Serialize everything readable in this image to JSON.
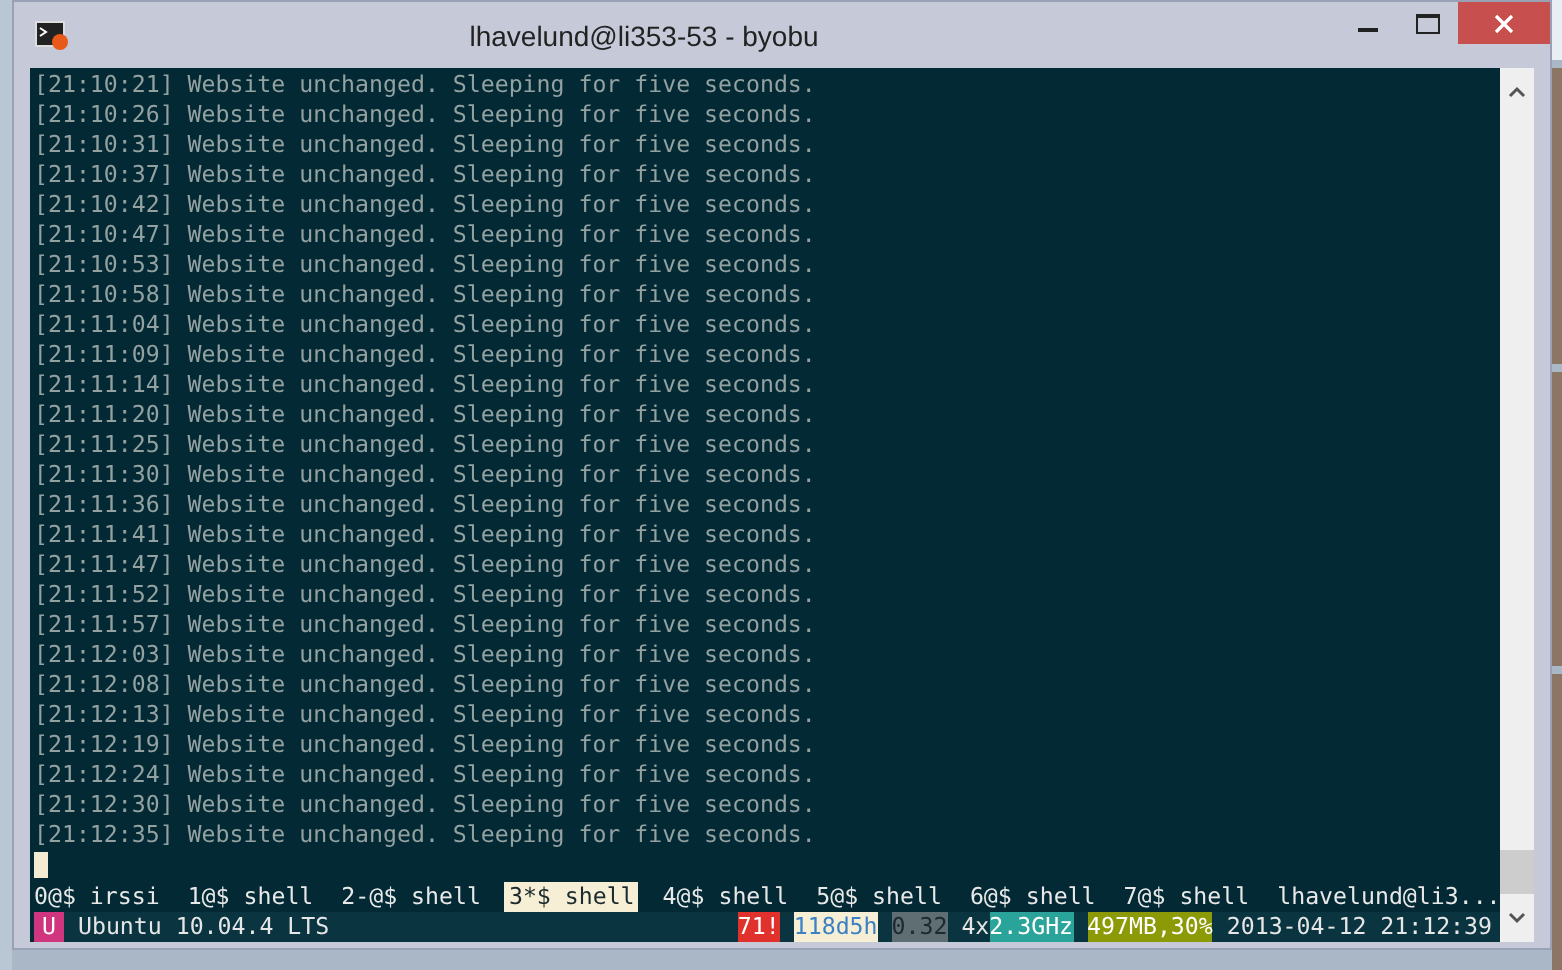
{
  "window": {
    "title": "lhavelund@li353-53 - byobu"
  },
  "terminal": {
    "lines": [
      "[21:10:21] Website unchanged. Sleeping for five seconds.",
      "[21:10:26] Website unchanged. Sleeping for five seconds.",
      "[21:10:31] Website unchanged. Sleeping for five seconds.",
      "[21:10:37] Website unchanged. Sleeping for five seconds.",
      "[21:10:42] Website unchanged. Sleeping for five seconds.",
      "[21:10:47] Website unchanged. Sleeping for five seconds.",
      "[21:10:53] Website unchanged. Sleeping for five seconds.",
      "[21:10:58] Website unchanged. Sleeping for five seconds.",
      "[21:11:04] Website unchanged. Sleeping for five seconds.",
      "[21:11:09] Website unchanged. Sleeping for five seconds.",
      "[21:11:14] Website unchanged. Sleeping for five seconds.",
      "[21:11:20] Website unchanged. Sleeping for five seconds.",
      "[21:11:25] Website unchanged. Sleeping for five seconds.",
      "[21:11:30] Website unchanged. Sleeping for five seconds.",
      "[21:11:36] Website unchanged. Sleeping for five seconds.",
      "[21:11:41] Website unchanged. Sleeping for five seconds.",
      "[21:11:47] Website unchanged. Sleeping for five seconds.",
      "[21:11:52] Website unchanged. Sleeping for five seconds.",
      "[21:11:57] Website unchanged. Sleeping for five seconds.",
      "[21:12:03] Website unchanged. Sleeping for five seconds.",
      "[21:12:08] Website unchanged. Sleeping for five seconds.",
      "[21:12:13] Website unchanged. Sleeping for five seconds.",
      "[21:12:19] Website unchanged. Sleeping for five seconds.",
      "[21:12:24] Website unchanged. Sleeping for five seconds.",
      "[21:12:30] Website unchanged. Sleeping for five seconds.",
      "[21:12:35] Website unchanged. Sleeping for five seconds."
    ]
  },
  "window_list": {
    "items": [
      {
        "label": "0@$ irssi",
        "selected": false
      },
      {
        "label": "1@$ shell",
        "selected": false
      },
      {
        "label": "2-@$ shell",
        "selected": false
      },
      {
        "label": "3*$ shell",
        "selected": true
      },
      {
        "label": "4@$ shell",
        "selected": false
      },
      {
        "label": "5@$ shell",
        "selected": false
      },
      {
        "label": "6@$ shell",
        "selected": false
      },
      {
        "label": "7@$ shell",
        "selected": false
      }
    ],
    "host": "lhavelund@li3..."
  },
  "status_bar": {
    "left": [
      {
        "text": "U",
        "kind": "logo",
        "color": "#d0357f"
      },
      {
        "text": "Ubuntu 10.04.4 LTS",
        "kind": "plain"
      }
    ],
    "right": [
      {
        "text": "71!",
        "kind": "alert",
        "color": "#e0312d"
      },
      {
        "text": "118d5h",
        "kind": "uptime",
        "color": "#f6efd6"
      },
      {
        "text": "0.32",
        "kind": "load",
        "color": "#5e6e73"
      },
      {
        "text": "4x",
        "kind": "plain"
      },
      {
        "text": "2.3GHz",
        "kind": "cpu",
        "color": "#2aa39a"
      },
      {
        "text": "497MB,30%",
        "kind": "mem",
        "color": "#8c9a08"
      },
      {
        "text": "2013-04-12 21:12:39",
        "kind": "plain"
      }
    ]
  }
}
